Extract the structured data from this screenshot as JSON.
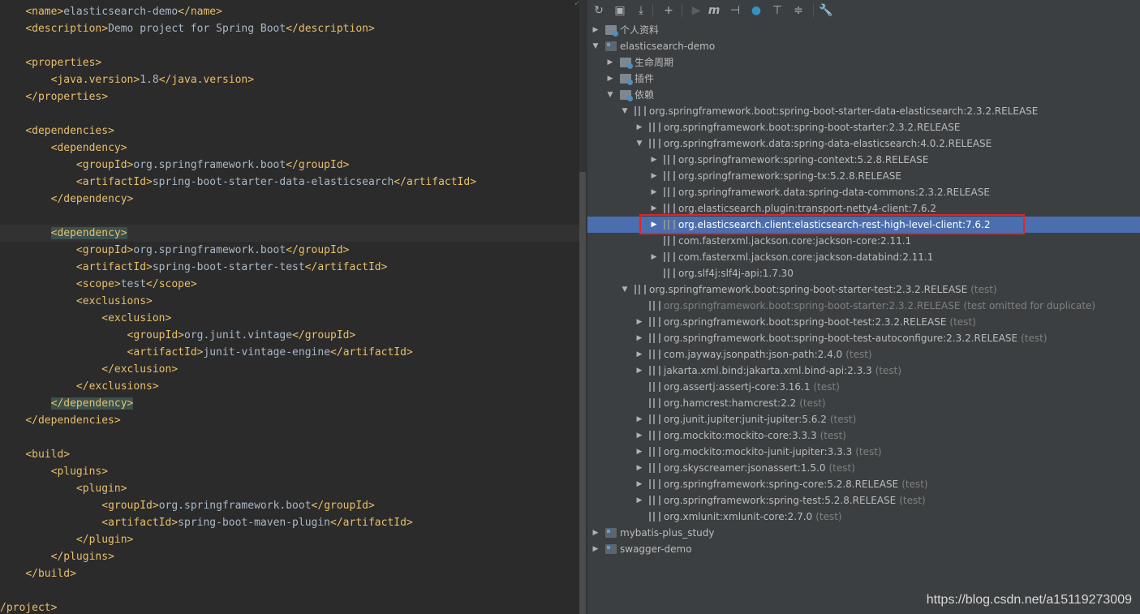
{
  "editor": {
    "lines": [
      {
        "indent": "    ",
        "tag": "name",
        "text": "elasticsearch-demo",
        "close": true
      },
      {
        "indent": "    ",
        "tag": "description",
        "text": "Demo project for Spring Boot",
        "close": true
      },
      {
        "indent": "",
        "tag": "",
        "text": "",
        "close": false
      },
      {
        "indent": "    ",
        "tag": "properties",
        "text": "",
        "close": false,
        "open_only": true
      },
      {
        "indent": "        ",
        "tag": "java.version",
        "text": "1.8",
        "close": true
      },
      {
        "indent": "    ",
        "tag": "/properties",
        "text": "",
        "close": false,
        "open_only": true
      },
      {
        "indent": "",
        "tag": "",
        "text": "",
        "close": false
      },
      {
        "indent": "    ",
        "tag": "dependencies",
        "text": "",
        "close": false,
        "open_only": true
      },
      {
        "indent": "        ",
        "tag": "dependency",
        "text": "",
        "close": false,
        "open_only": true
      },
      {
        "indent": "            ",
        "tag": "groupId",
        "text": "org.springframework.boot",
        "close": true
      },
      {
        "indent": "            ",
        "tag": "artifactId",
        "text": "spring-boot-starter-data-elasticsearch",
        "close": true
      },
      {
        "indent": "        ",
        "tag": "/dependency",
        "text": "",
        "close": false,
        "open_only": true
      },
      {
        "indent": "",
        "tag": "",
        "text": "",
        "close": false
      },
      {
        "indent": "        ",
        "tag": "dependency",
        "text": "",
        "close": false,
        "open_only": true,
        "highlight": true,
        "current": true
      },
      {
        "indent": "            ",
        "tag": "groupId",
        "text": "org.springframework.boot",
        "close": true
      },
      {
        "indent": "            ",
        "tag": "artifactId",
        "text": "spring-boot-starter-test",
        "close": true
      },
      {
        "indent": "            ",
        "tag": "scope",
        "text": "test",
        "close": true
      },
      {
        "indent": "            ",
        "tag": "exclusions",
        "text": "",
        "close": false,
        "open_only": true
      },
      {
        "indent": "                ",
        "tag": "exclusion",
        "text": "",
        "close": false,
        "open_only": true
      },
      {
        "indent": "                    ",
        "tag": "groupId",
        "text": "org.junit.vintage",
        "close": true
      },
      {
        "indent": "                    ",
        "tag": "artifactId",
        "text": "junit-vintage-engine",
        "close": true
      },
      {
        "indent": "                ",
        "tag": "/exclusion",
        "text": "",
        "close": false,
        "open_only": true
      },
      {
        "indent": "            ",
        "tag": "/exclusions",
        "text": "",
        "close": false,
        "open_only": true
      },
      {
        "indent": "        ",
        "tag": "/dependency",
        "text": "",
        "close": false,
        "open_only": true,
        "highlight": true
      },
      {
        "indent": "    ",
        "tag": "/dependencies",
        "text": "",
        "close": false,
        "open_only": true
      },
      {
        "indent": "",
        "tag": "",
        "text": "",
        "close": false
      },
      {
        "indent": "    ",
        "tag": "build",
        "text": "",
        "close": false,
        "open_only": true
      },
      {
        "indent": "        ",
        "tag": "plugins",
        "text": "",
        "close": false,
        "open_only": true
      },
      {
        "indent": "            ",
        "tag": "plugin",
        "text": "",
        "close": false,
        "open_only": true
      },
      {
        "indent": "                ",
        "tag": "groupId",
        "text": "org.springframework.boot",
        "close": true
      },
      {
        "indent": "                ",
        "tag": "artifactId",
        "text": "spring-boot-maven-plugin",
        "close": true
      },
      {
        "indent": "            ",
        "tag": "/plugin",
        "text": "",
        "close": false,
        "open_only": true
      },
      {
        "indent": "        ",
        "tag": "/plugins",
        "text": "",
        "close": false,
        "open_only": true
      },
      {
        "indent": "    ",
        "tag": "/build",
        "text": "",
        "close": false,
        "open_only": true
      },
      {
        "indent": "",
        "tag": "",
        "text": "",
        "close": false
      },
      {
        "indent": "",
        "tag": "/project",
        "text": "",
        "close": false,
        "open_only": true,
        "no_open_bracket": true
      }
    ]
  },
  "toolbar": {
    "icons": [
      "reload-icon",
      "add-folder-icon",
      "download-icon",
      "plus-icon",
      "run-icon",
      "maven-goal-icon",
      "toggle-offline-icon",
      "skip-tests-icon",
      "show-dependencies-icon",
      "collapse-all-icon",
      "settings-icon"
    ],
    "glyphs": [
      "↻",
      "▣",
      "⤓",
      "+",
      "▶",
      "m",
      "⊣",
      "●",
      "⊤",
      "≑",
      "🔧"
    ]
  },
  "tree": [
    {
      "indent": 0,
      "arrow": "▶",
      "icon": "folder",
      "label": "个人资料",
      "scope": ""
    },
    {
      "indent": 0,
      "arrow": "▼",
      "icon": "module",
      "label": "elasticsearch-demo",
      "scope": ""
    },
    {
      "indent": 1,
      "arrow": "▶",
      "icon": "folder",
      "label": "生命周期",
      "scope": ""
    },
    {
      "indent": 1,
      "arrow": "▶",
      "icon": "folder",
      "label": "插件",
      "scope": ""
    },
    {
      "indent": 1,
      "arrow": "▼",
      "icon": "folder",
      "label": "依赖",
      "scope": ""
    },
    {
      "indent": 2,
      "arrow": "▼",
      "icon": "lib",
      "label": "org.springframework.boot:spring-boot-starter-data-elasticsearch:2.3.2.RELEASE",
      "scope": ""
    },
    {
      "indent": 3,
      "arrow": "▶",
      "icon": "lib",
      "label": "org.springframework.boot:spring-boot-starter:2.3.2.RELEASE",
      "scope": ""
    },
    {
      "indent": 3,
      "arrow": "▼",
      "icon": "lib",
      "label": "org.springframework.data:spring-data-elasticsearch:4.0.2.RELEASE",
      "scope": ""
    },
    {
      "indent": 4,
      "arrow": "▶",
      "icon": "lib",
      "label": "org.springframework:spring-context:5.2.8.RELEASE",
      "scope": ""
    },
    {
      "indent": 4,
      "arrow": "▶",
      "icon": "lib",
      "label": "org.springframework:spring-tx:5.2.8.RELEASE",
      "scope": ""
    },
    {
      "indent": 4,
      "arrow": "▶",
      "icon": "lib",
      "label": "org.springframework.data:spring-data-commons:2.3.2.RELEASE",
      "scope": ""
    },
    {
      "indent": 4,
      "arrow": "▶",
      "icon": "lib",
      "label": "org.elasticsearch.plugin:transport-netty4-client:7.6.2",
      "scope": ""
    },
    {
      "indent": 4,
      "arrow": "▶",
      "icon": "lib",
      "label": "org.elasticsearch.client:elasticsearch-rest-high-level-client:7.6.2",
      "scope": "",
      "selected": true
    },
    {
      "indent": 4,
      "arrow": "",
      "icon": "lib",
      "label": "com.fasterxml.jackson.core:jackson-core:2.11.1",
      "scope": ""
    },
    {
      "indent": 4,
      "arrow": "▶",
      "icon": "lib",
      "label": "com.fasterxml.jackson.core:jackson-databind:2.11.1",
      "scope": ""
    },
    {
      "indent": 4,
      "arrow": "",
      "icon": "lib",
      "label": "org.slf4j:slf4j-api:1.7.30",
      "scope": ""
    },
    {
      "indent": 2,
      "arrow": "▼",
      "icon": "lib",
      "label": "org.springframework.boot:spring-boot-starter-test:2.3.2.RELEASE",
      "scope": "(test)"
    },
    {
      "indent": 3,
      "arrow": "",
      "icon": "lib",
      "label": "org.springframework.boot:spring-boot-starter:2.3.2.RELEASE",
      "scope": "(test omitted for duplicate)",
      "dup": true
    },
    {
      "indent": 3,
      "arrow": "▶",
      "icon": "lib",
      "label": "org.springframework.boot:spring-boot-test:2.3.2.RELEASE",
      "scope": "(test)"
    },
    {
      "indent": 3,
      "arrow": "▶",
      "icon": "lib",
      "label": "org.springframework.boot:spring-boot-test-autoconfigure:2.3.2.RELEASE",
      "scope": "(test)"
    },
    {
      "indent": 3,
      "arrow": "▶",
      "icon": "lib",
      "label": "com.jayway.jsonpath:json-path:2.4.0",
      "scope": "(test)"
    },
    {
      "indent": 3,
      "arrow": "▶",
      "icon": "lib",
      "label": "jakarta.xml.bind:jakarta.xml.bind-api:2.3.3",
      "scope": "(test)"
    },
    {
      "indent": 3,
      "arrow": "",
      "icon": "lib",
      "label": "org.assertj:assertj-core:3.16.1",
      "scope": "(test)"
    },
    {
      "indent": 3,
      "arrow": "",
      "icon": "lib",
      "label": "org.hamcrest:hamcrest:2.2",
      "scope": "(test)"
    },
    {
      "indent": 3,
      "arrow": "▶",
      "icon": "lib",
      "label": "org.junit.jupiter:junit-jupiter:5.6.2",
      "scope": "(test)"
    },
    {
      "indent": 3,
      "arrow": "▶",
      "icon": "lib",
      "label": "org.mockito:mockito-core:3.3.3",
      "scope": "(test)"
    },
    {
      "indent": 3,
      "arrow": "▶",
      "icon": "lib",
      "label": "org.mockito:mockito-junit-jupiter:3.3.3",
      "scope": "(test)"
    },
    {
      "indent": 3,
      "arrow": "▶",
      "icon": "lib",
      "label": "org.skyscreamer:jsonassert:1.5.0",
      "scope": "(test)"
    },
    {
      "indent": 3,
      "arrow": "▶",
      "icon": "lib",
      "label": "org.springframework:spring-core:5.2.8.RELEASE",
      "scope": "(test)"
    },
    {
      "indent": 3,
      "arrow": "▶",
      "icon": "lib",
      "label": "org.springframework:spring-test:5.2.8.RELEASE",
      "scope": "(test)"
    },
    {
      "indent": 3,
      "arrow": "",
      "icon": "lib",
      "label": "org.xmlunit:xmlunit-core:2.7.0",
      "scope": "(test)"
    },
    {
      "indent": 0,
      "arrow": "▶",
      "icon": "module",
      "label": "mybatis-plus_study",
      "scope": ""
    },
    {
      "indent": 0,
      "arrow": "▶",
      "icon": "module",
      "label": "swagger-demo",
      "scope": ""
    }
  ],
  "watermark": "https://blog.csdn.net/a15119273009",
  "colors": {
    "selection": "#4b6eaf",
    "annotation_box": "#e0252b",
    "tag": "#e8bf6a"
  }
}
